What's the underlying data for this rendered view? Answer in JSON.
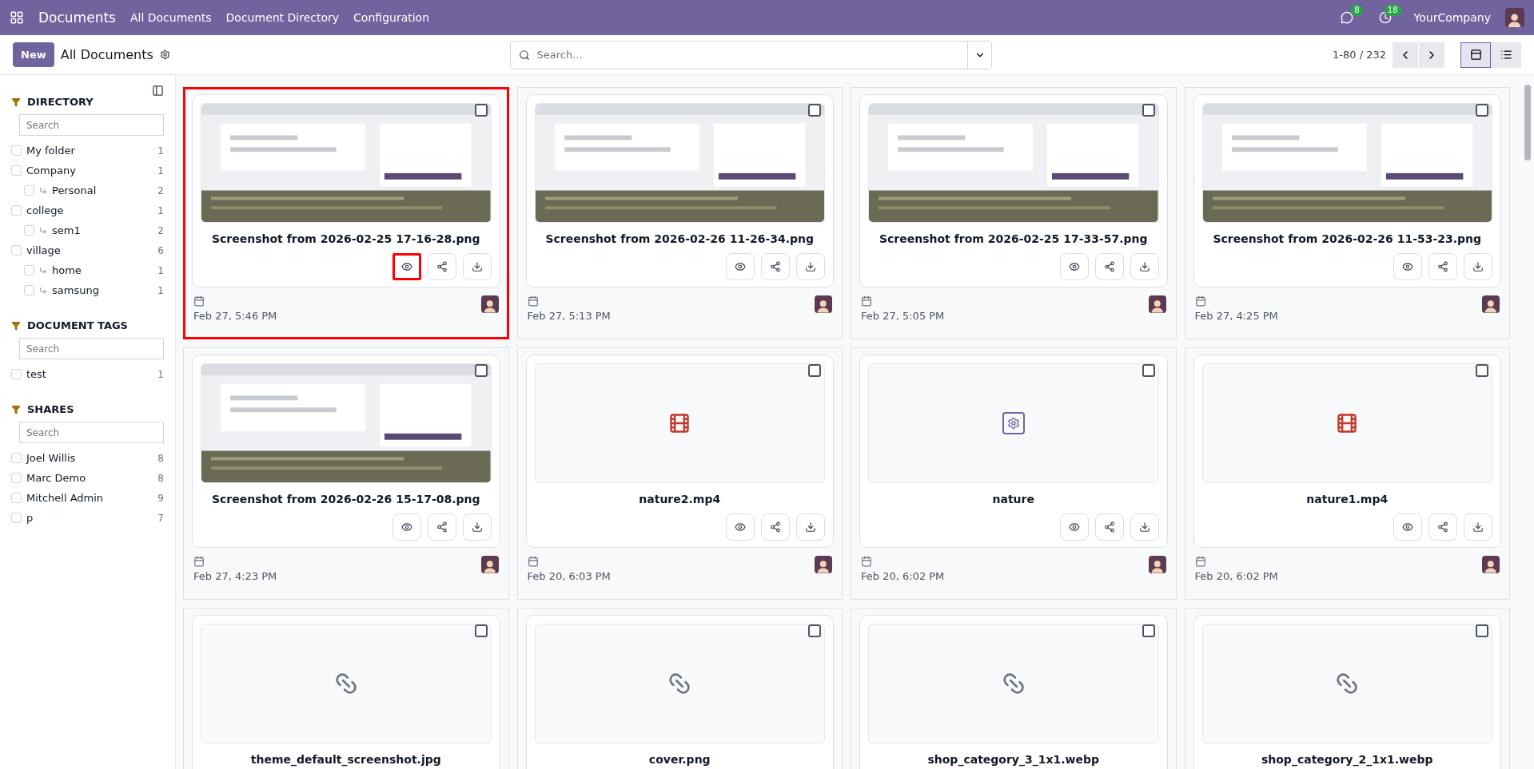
{
  "navbar": {
    "app": "Documents",
    "menu": [
      "All Documents",
      "Document Directory",
      "Configuration"
    ],
    "messages_badge": "8",
    "activities_badge": "18",
    "company": "YourCompany"
  },
  "control": {
    "new_button": "New",
    "breadcrumb": "All Documents",
    "search": {
      "placeholder": "Search..."
    },
    "pager": "1-80 / 232",
    "views": [
      {
        "kind": "kanban",
        "selected": true
      },
      {
        "kind": "list",
        "selected": false
      }
    ]
  },
  "sidebar": {
    "sections": [
      {
        "title": "DIRECTORY",
        "search": {
          "placeholder": "Search"
        },
        "items": [
          {
            "label": "My folder",
            "count": "1",
            "checked": false
          },
          {
            "label": "Company",
            "count": "1",
            "checked": false,
            "children": [
              {
                "label": "Personal",
                "count": "2",
                "checked": false
              }
            ]
          },
          {
            "label": "college",
            "count": "1",
            "checked": false,
            "children": [
              {
                "label": "sem1",
                "count": "2",
                "checked": false
              }
            ]
          },
          {
            "label": "village",
            "count": "6",
            "checked": false,
            "children": [
              {
                "label": "home",
                "count": "1",
                "checked": false
              },
              {
                "label": "samsung",
                "count": "1",
                "checked": false
              }
            ]
          }
        ]
      },
      {
        "title": "DOCUMENT TAGS",
        "search": {
          "placeholder": "Search"
        },
        "items": [
          {
            "label": "test",
            "count": "1",
            "checked": false
          }
        ]
      },
      {
        "title": "SHARES",
        "search": {
          "placeholder": "Search"
        },
        "items": [
          {
            "label": "Joel Willis",
            "count": "8",
            "checked": false
          },
          {
            "label": "Marc Demo",
            "count": "8",
            "checked": false
          },
          {
            "label": "Mitchell Admin",
            "count": "9",
            "checked": false
          },
          {
            "label": "p",
            "count": "7",
            "checked": false
          }
        ]
      }
    ]
  },
  "documents": [
    {
      "name": "Screenshot from 2026-02-25 17-16-28.png",
      "kind": "picture",
      "date": "Feb 27, 5:46 PM",
      "checked": false,
      "highlighted": true,
      "view_button_highlighted": true
    },
    {
      "name": "Screenshot from 2026-02-26 11-26-34.png",
      "kind": "picture",
      "date": "Feb 27, 5:13 PM",
      "checked": false,
      "highlighted": false
    },
    {
      "name": "Screenshot from 2026-02-25 17-33-57.png",
      "kind": "picture",
      "date": "Feb 27, 5:05 PM",
      "checked": false,
      "highlighted": false
    },
    {
      "name": "Screenshot from 2026-02-26 11-53-23.png",
      "kind": "picture",
      "date": "Feb 27, 4:25 PM",
      "checked": false,
      "highlighted": false
    },
    {
      "name": "Screenshot from 2026-02-26 15-17-08.png",
      "kind": "picture",
      "date": "Feb 27, 4:23 PM",
      "checked": false,
      "highlighted": false
    },
    {
      "name": "nature2.mp4",
      "kind": "video",
      "date": "Feb 20, 6:03 PM",
      "checked": false,
      "highlighted": false
    },
    {
      "name": "nature",
      "kind": "gear",
      "date": "Feb 20, 6:02 PM",
      "checked": false,
      "highlighted": false
    },
    {
      "name": "nature1.mp4",
      "kind": "video",
      "date": "Feb 20, 6:02 PM",
      "checked": false,
      "highlighted": false
    },
    {
      "name": "theme_default_screenshot.jpg",
      "kind": "link",
      "checked": false,
      "highlighted": false
    },
    {
      "name": "cover.png",
      "kind": "link",
      "checked": false,
      "highlighted": false
    },
    {
      "name": "shop_category_3_1x1.webp",
      "kind": "link",
      "checked": false,
      "highlighted": false
    },
    {
      "name": "shop_category_2_1x1.webp",
      "kind": "link",
      "checked": false,
      "highlighted": false
    }
  ]
}
